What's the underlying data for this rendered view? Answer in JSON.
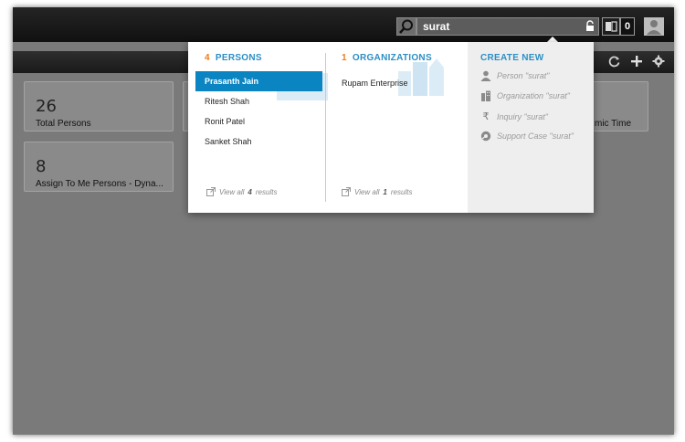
{
  "search": {
    "query": "surat"
  },
  "notifications": {
    "count": "0"
  },
  "tiles": [
    {
      "value": "26",
      "label": "Total Persons"
    },
    {
      "value": "8",
      "label": "Assign To Me Persons - Dyna..."
    },
    {
      "value": "",
      "label": "mic Time"
    }
  ],
  "persons": {
    "count": "4",
    "header": "PERSONS",
    "items": [
      "Prasanth Jain",
      "Ritesh Shah",
      "Ronit Patel",
      "Sanket Shah"
    ],
    "selected_index": 0,
    "view_all_prefix": "View all",
    "view_all_count": "4",
    "view_all_suffix": "results"
  },
  "organizations": {
    "count": "1",
    "header": "ORGANIZATIONS",
    "items": [
      "Rupam Enterprise"
    ],
    "view_all_prefix": "View all",
    "view_all_count": "1",
    "view_all_suffix": "results"
  },
  "create_new": {
    "header": "CREATE NEW",
    "items": [
      {
        "icon": "person-icon",
        "label": "Person \"surat\""
      },
      {
        "icon": "organization-icon",
        "label": "Organization \"surat\""
      },
      {
        "icon": "rupee-icon",
        "label": "Inquiry \"surat\""
      },
      {
        "icon": "support-icon",
        "label": "Support Case \"surat\""
      }
    ]
  },
  "colors": {
    "accent_blue": "#2b8ec6",
    "accent_orange": "#f07a1a",
    "selected_row": "#0a85c2"
  }
}
